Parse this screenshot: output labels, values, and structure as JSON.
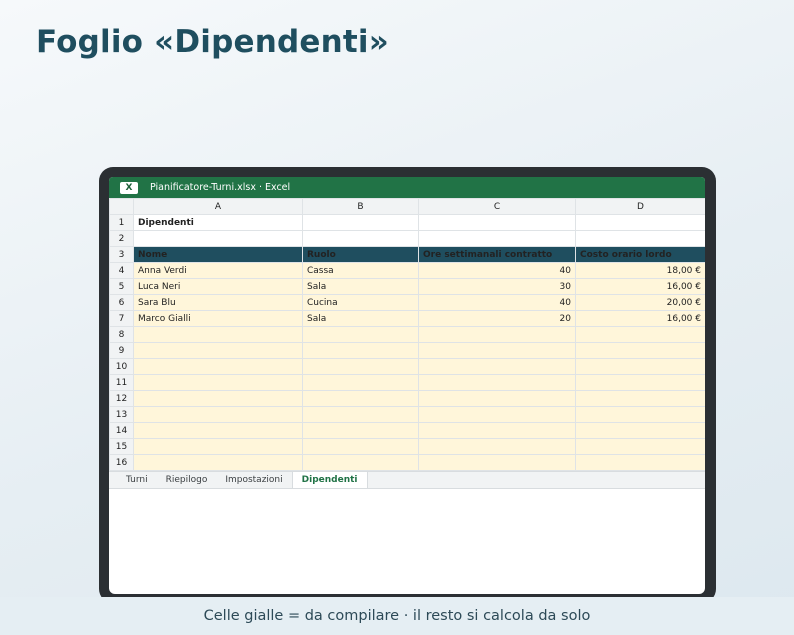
{
  "page": {
    "title": "Foglio «Dipendenti»",
    "footer": "Celle gialle = da compilare · il resto si calcola da solo"
  },
  "window": {
    "app_icon": "X",
    "title": "Pianificatore-Turni.xlsx · Excel"
  },
  "sheet": {
    "columns": [
      "A",
      "B",
      "C",
      "D"
    ],
    "rows": [
      {
        "n": "1",
        "cells": [
          "Dipendenti",
          "",
          "",
          ""
        ]
      },
      {
        "n": "2",
        "cells": [
          "",
          "",
          "",
          ""
        ]
      },
      {
        "n": "3",
        "cells": [
          "Nome",
          "Ruolo",
          "Ore settimanali contratto",
          "Costo orario lordo"
        ]
      },
      {
        "n": "4",
        "cells": [
          "Anna Verdi",
          "Cassa",
          "40",
          "18,00 €"
        ]
      },
      {
        "n": "5",
        "cells": [
          "Luca Neri",
          "Sala",
          "30",
          "16,00 €"
        ]
      },
      {
        "n": "6",
        "cells": [
          "Sara Blu",
          "Cucina",
          "40",
          "20,00 €"
        ]
      },
      {
        "n": "7",
        "cells": [
          "Marco Gialli",
          "Sala",
          "20",
          "16,00 €"
        ]
      },
      {
        "n": "8",
        "cells": [
          "",
          "",
          "",
          ""
        ]
      },
      {
        "n": "9",
        "cells": [
          "",
          "",
          "",
          ""
        ]
      },
      {
        "n": "10",
        "cells": [
          "",
          "",
          "",
          ""
        ]
      },
      {
        "n": "11",
        "cells": [
          "",
          "",
          "",
          ""
        ]
      },
      {
        "n": "12",
        "cells": [
          "",
          "",
          "",
          ""
        ]
      },
      {
        "n": "13",
        "cells": [
          "",
          "",
          "",
          ""
        ]
      },
      {
        "n": "14",
        "cells": [
          "",
          "",
          "",
          ""
        ]
      },
      {
        "n": "15",
        "cells": [
          "",
          "",
          "",
          ""
        ]
      },
      {
        "n": "16",
        "cells": [
          "",
          "",
          "",
          ""
        ]
      }
    ],
    "tabs": [
      "Turni",
      "Riepilogo",
      "Impostazioni",
      "Dipendenti"
    ],
    "active_tab": "Dipendenti"
  },
  "colors": {
    "accent": "#1f4e5f",
    "excel_green": "#217346",
    "input_yellow": "#fff6da"
  }
}
